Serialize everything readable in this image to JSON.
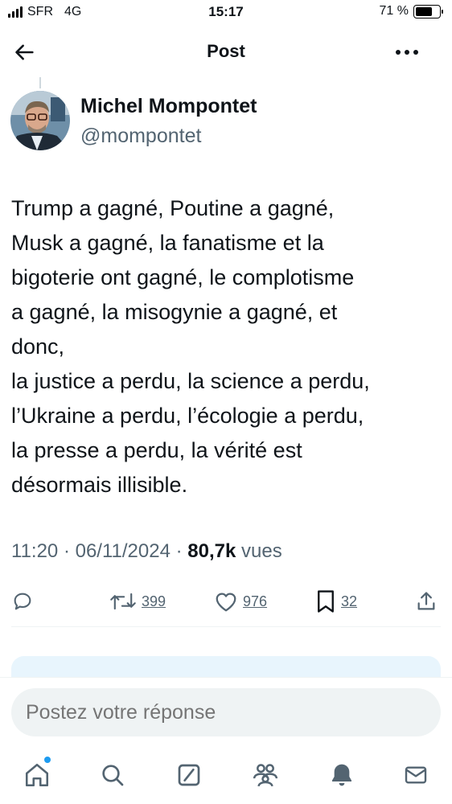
{
  "status_bar": {
    "carrier": "SFR",
    "network": "4G",
    "time": "15:17",
    "battery": "71 %",
    "battery_level": 0.71
  },
  "header": {
    "title": "Post",
    "back_icon": "arrow-left-icon",
    "more_icon": "more-horizontal-icon"
  },
  "author": {
    "name": "Michel Mompontet",
    "handle": "@mompontet"
  },
  "tweet": {
    "lines": [
      "Trump a gagné, Poutine a gagné,",
      "Musk a gagné, la fanatisme et la",
      "bigoterie ont gagné, le complotisme",
      "a gagné, la misogynie a gagné, et",
      "donc,",
      "la justice a perdu, la science a perdu,",
      "l’Ukraine a perdu, l’écologie a perdu,",
      "la presse a perdu, la vérité est",
      "désormais illisible."
    ]
  },
  "meta": {
    "time": "11:20",
    "separator": " · ",
    "date": "06/11/2024",
    "views_count": "80,7k",
    "views_label": " vues"
  },
  "actions": {
    "reply_icon": "reply-icon",
    "retweet_icon": "retweet-icon",
    "retweets": "399",
    "like_icon": "heart-icon",
    "likes": "976",
    "bookmark_icon": "bookmark-icon",
    "bookmarks": "32",
    "share_icon": "share-icon"
  },
  "reply": {
    "placeholder": "Postez votre réponse"
  },
  "tabs": [
    "home-icon",
    "search-icon",
    "grok-icon",
    "communities-icon",
    "notifications-icon",
    "messages-icon"
  ],
  "colors": {
    "accent": "#1d9bf0",
    "text": "#0f1419",
    "secondary": "#536471"
  }
}
